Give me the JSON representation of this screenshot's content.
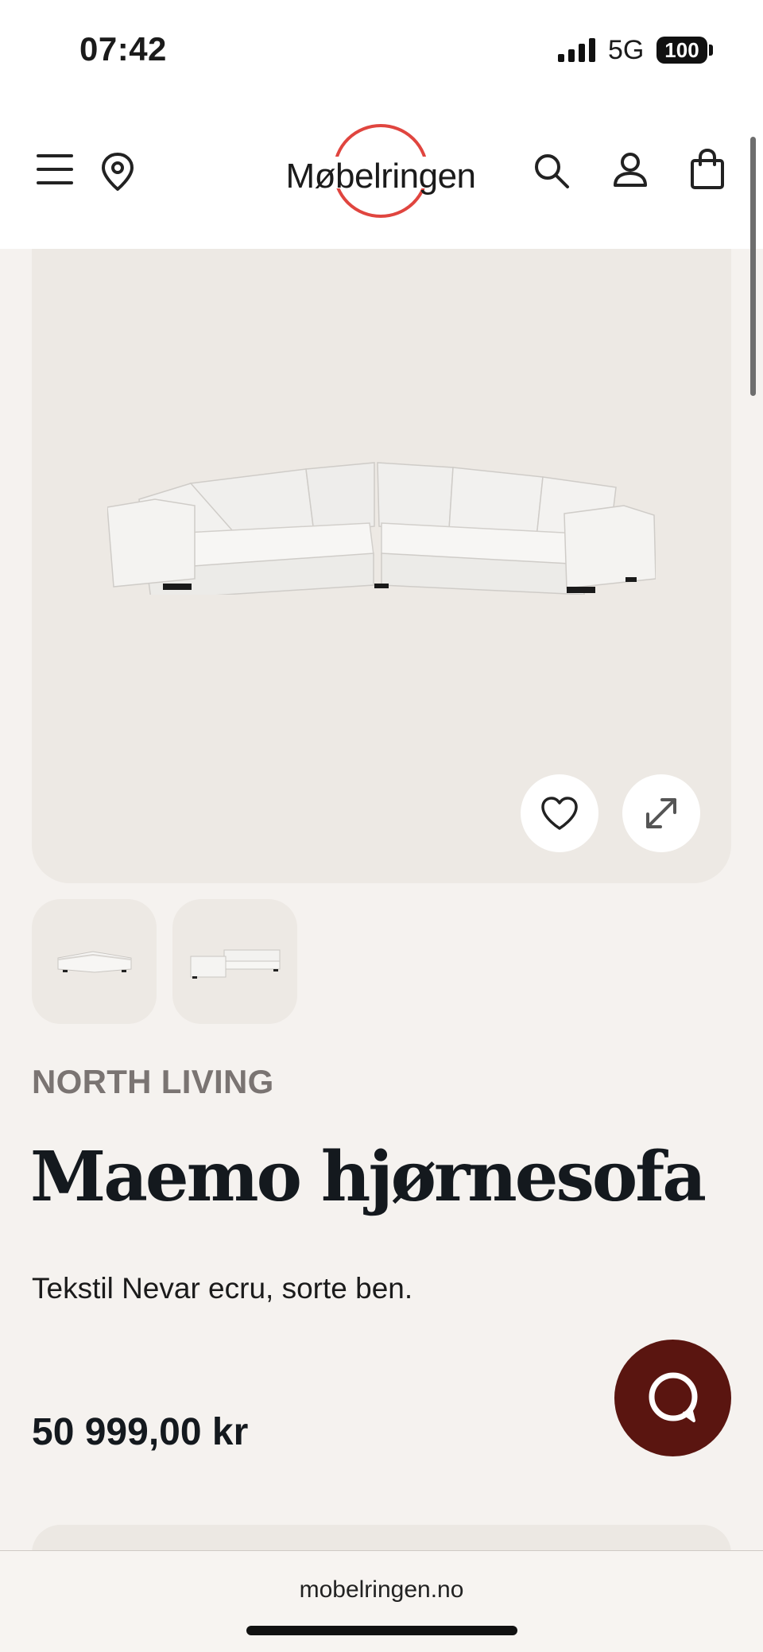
{
  "status_bar": {
    "time": "07:42",
    "network": "5G",
    "battery": "100",
    "icons": [
      "signal-icon",
      "battery-icon"
    ]
  },
  "header": {
    "logo": "Møbelringen",
    "icons": [
      "menu-icon",
      "location-pin-icon",
      "search-icon",
      "user-icon",
      "shopping-bag-icon"
    ],
    "accent_color": "#e0453f"
  },
  "product": {
    "brand": "NORTH LIVING",
    "title": "Maemo hjørnesofa",
    "description": "Tekstil Nevar ecru, sorte ben.",
    "price": "50 999,00 kr",
    "gallery_icons": [
      "heart-icon",
      "expand-icon"
    ],
    "thumbnail_count": 2
  },
  "chat": {
    "icon": "chat-bubble-icon",
    "color": "#5a1510"
  },
  "browser": {
    "url": "mobelringen.no"
  }
}
